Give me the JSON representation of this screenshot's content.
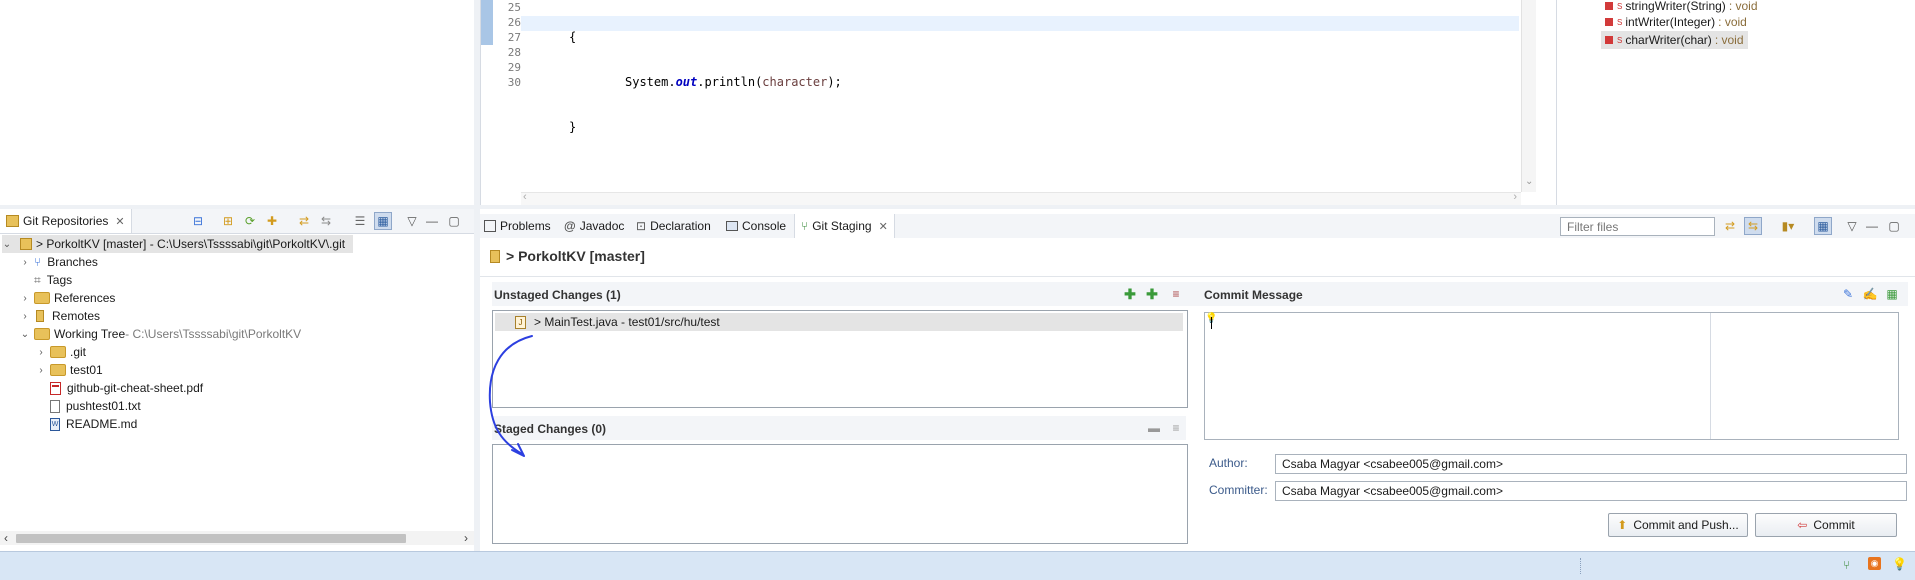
{
  "colors": {
    "accent": "#3b73d9",
    "panel_bg": "#f3f5f8",
    "selection": "#dbe6f7",
    "statusbar": "#d8e6f5",
    "annotation": "#2c3fe0"
  },
  "code": {
    "lines": [
      {
        "num": "25",
        "text": "{"
      },
      {
        "num": "26",
        "text": "System.out.println(character);"
      },
      {
        "num": "27",
        "text": "}"
      },
      {
        "num": "28",
        "text": ""
      },
      {
        "num": "29",
        "text": "}"
      },
      {
        "num": "30",
        "text": ""
      }
    ],
    "sys": "System.",
    "out": "out",
    "println": ".println(",
    "arg": "character",
    "tail": ");"
  },
  "outline": {
    "items": [
      {
        "name": "stringWriter(String)",
        "type": ": void"
      },
      {
        "name": "intWriter(Integer)",
        "type": ": void"
      },
      {
        "name": "charWriter(char)",
        "type": ": void"
      }
    ],
    "modifier": "S"
  },
  "git_repos": {
    "tab_title": "Git Repositories",
    "repo_label": "> PorkoltKV [master] - C:\\Users\\Tssssabi\\git\\PorkoltKV\\.git",
    "branches": "Branches",
    "tags": "Tags",
    "references": "References",
    "remotes": "Remotes",
    "working_tree": "Working Tree",
    "working_tree_path": " - C:\\Users\\Tssssabi\\git\\PorkoltKV",
    "files": [
      ".git",
      "test01",
      "github-git-cheat-sheet.pdf",
      "pushtest01.txt",
      "README.md"
    ]
  },
  "bottom_tabs": {
    "problems": "Problems",
    "javadoc": "Javadoc",
    "declaration": "Declaration",
    "console": "Console",
    "git_staging": "Git Staging",
    "filter_placeholder": "Filter files"
  },
  "staging": {
    "repo_title": "> PorkoltKV [master]",
    "unstaged_title": "Unstaged Changes (1)",
    "unstaged_item": "> MainTest.java - test01/src/hu/test",
    "staged_title": "Staged Changes (0)",
    "commit_message_title": "Commit Message",
    "author_label": "Author:",
    "author_value": "Csaba Magyar <csabee005@gmail.com>",
    "committer_label": "Committer:",
    "committer_value": "Csaba Magyar <csabee005@gmail.com>",
    "commit_push_label": "Commit and Push...",
    "commit_label": "Commit"
  }
}
